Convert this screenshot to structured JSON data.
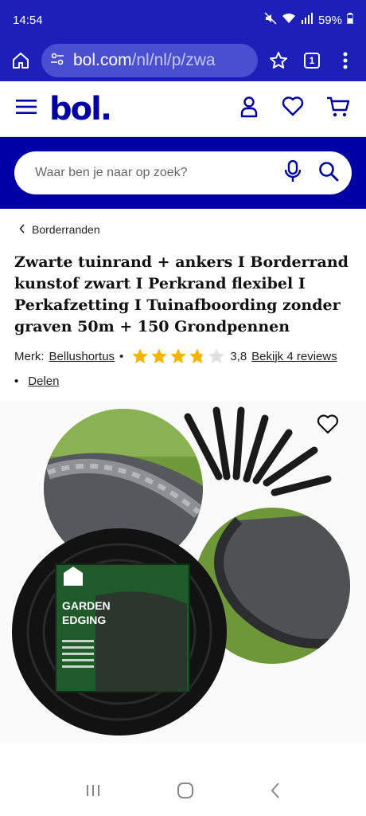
{
  "status_bar": {
    "time": "14:54",
    "battery": "59%"
  },
  "browser": {
    "url_host": "bol.com",
    "url_path": "/nl/nl/p/zwa",
    "tab_count": "1"
  },
  "search": {
    "placeholder": "Waar ben je naar op zoek?"
  },
  "breadcrumb": {
    "label": "Borderranden"
  },
  "product": {
    "title": "Zwarte tuinrand + ankers I Borderrand kunstof zwart I Perkrand flexibel I Perkafzetting I Tuinafboording zonder graven 50m + 150 Grondpennen",
    "brand_label": "Merk:",
    "brand": "Bellushortus",
    "rating": "3,8",
    "rating_value": 3.8,
    "reviews_link": "Bekijk 4 reviews",
    "share_label": "Delen"
  },
  "package": {
    "title_line1": "GARDEN",
    "title_line2": "EDGING"
  },
  "colors": {
    "brand_blue": "#0000a4",
    "status_blue": "#1c1fb8",
    "star_yellow": "#f5b400"
  }
}
